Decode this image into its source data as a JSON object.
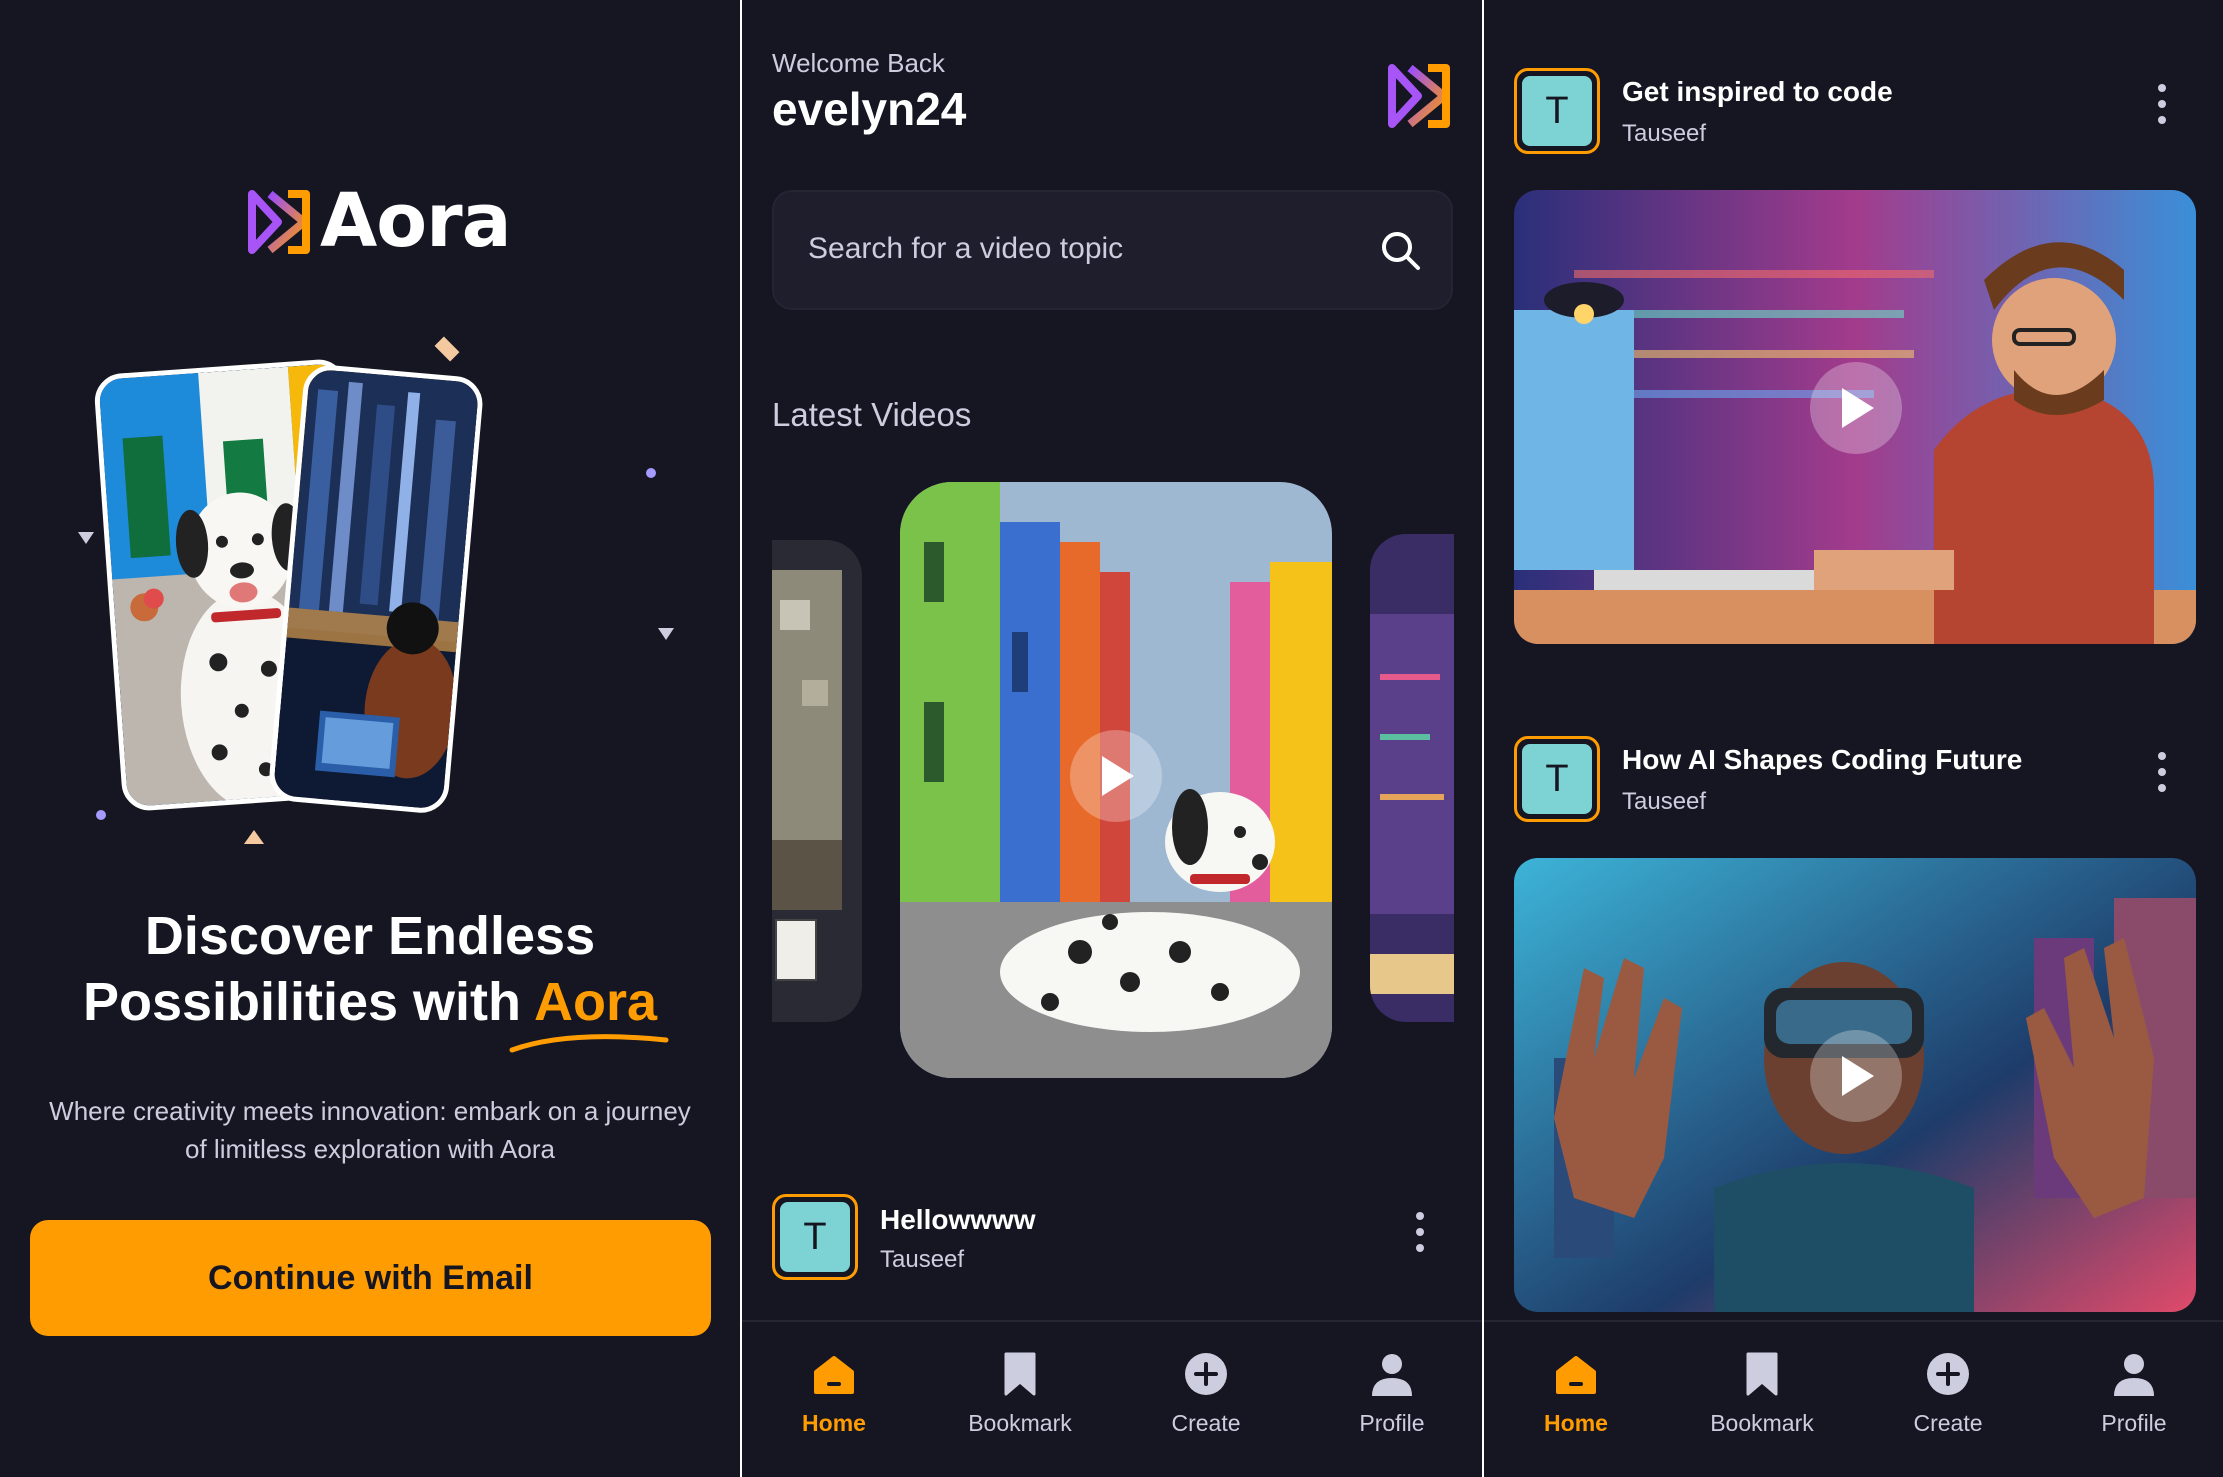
{
  "colors": {
    "background": "#161622",
    "accent": "#FF9C01",
    "surface": "#1E1E2D",
    "text_muted": "#CDCDE0",
    "avatar": "#7DD3D3"
  },
  "onboarding": {
    "logo_text": "Aora",
    "title_line1": "Discover Endless",
    "title_line2_prefix": "Possibilities with",
    "title_accent": "Aora",
    "subtitle": "Where creativity meets innovation: embark on a journey of limitless exploration with Aora",
    "cta_label": "Continue with Email"
  },
  "home": {
    "welcome": "Welcome Back",
    "username": "evelyn24",
    "search_placeholder": "Search for a video topic",
    "latest_title": "Latest Videos",
    "post": {
      "title": "Hellowwww",
      "author": "Tauseef",
      "avatar_letter": "T"
    }
  },
  "feed": {
    "posts": [
      {
        "title": "Get inspired to code",
        "author": "Tauseef",
        "avatar_letter": "T"
      },
      {
        "title": "How AI Shapes Coding Future",
        "author": "Tauseef",
        "avatar_letter": "T"
      }
    ]
  },
  "tabs": [
    {
      "label": "Home",
      "icon": "home-icon",
      "active": true
    },
    {
      "label": "Bookmark",
      "icon": "bookmark-icon",
      "active": false
    },
    {
      "label": "Create",
      "icon": "plus-circle-icon",
      "active": false
    },
    {
      "label": "Profile",
      "icon": "profile-icon",
      "active": false
    }
  ]
}
